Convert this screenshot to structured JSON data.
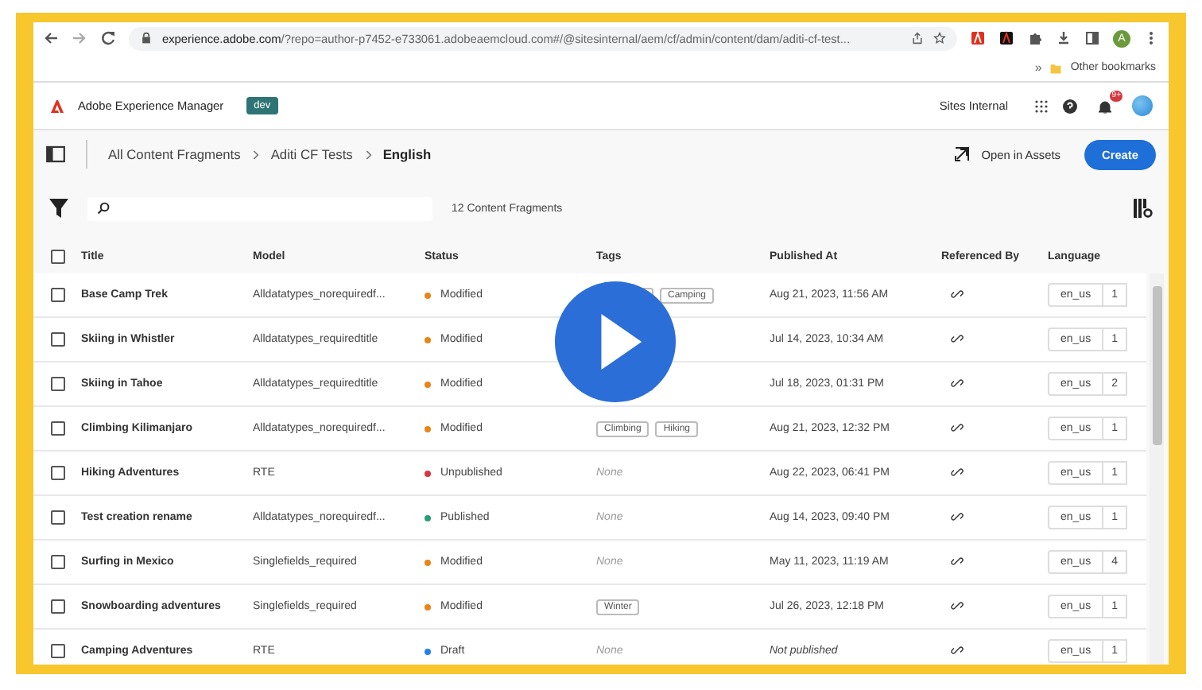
{
  "browser": {
    "url_host": "experience.adobe.com",
    "url_rest": "/?repo=author-p7452-e733061.adobeaemcloud.com#/@sitesinternal/aem/cf/admin/content/dam/aditi-cf-test...",
    "bookmarks_more": "»",
    "bookmark": "Other bookmarks",
    "profile": "A"
  },
  "app": {
    "product": "Adobe Experience Manager",
    "env": "dev",
    "org": "Sites Internal",
    "notification_badge": "9+"
  },
  "breadcrumb": [
    {
      "label": "All Content Fragments",
      "current": false
    },
    {
      "label": "Aditi CF Tests",
      "current": false
    },
    {
      "label": "English",
      "current": true
    }
  ],
  "actions": {
    "open_assets": "Open in Assets",
    "create": "Create"
  },
  "toolbar": {
    "count": "12 Content Fragments"
  },
  "table": {
    "columns": [
      "Title",
      "Model",
      "Status",
      "Tags",
      "Published At",
      "Referenced By",
      "Language"
    ],
    "select_all_checked": false,
    "rows": [
      {
        "checked": false,
        "hidden_tag": true,
        "title": "Base Camp Trek",
        "model": "Alldatatypes_norequiredf...",
        "status": "Modified",
        "color": "#e68619",
        "tags": [
          "Camping"
        ],
        "published": "Aug 21, 2023, 11:56 AM",
        "published_missing": false,
        "language": "en_us",
        "versions": "1"
      },
      {
        "checked": false,
        "title": "Skiing in Whistler",
        "model": "Alldatatypes_requiredtitle",
        "status": "Modified",
        "color": "#e68619",
        "published": "Jul 14, 2023, 10:34 AM",
        "published_missing": false,
        "language": "en_us",
        "versions": "1"
      },
      {
        "checked": false,
        "hidden_tag": true,
        "title": "Skiing in Tahoe",
        "model": "Alldatatypes_requiredtitle",
        "status": "Modified",
        "color": "#e68619",
        "published": "Jul 18, 2023, 01:31 PM",
        "published_missing": false,
        "language": "en_us",
        "versions": "2"
      },
      {
        "checked": false,
        "title": "Climbing Kilimanjaro",
        "model": "Alldatatypes_norequiredf...",
        "status": "Modified",
        "color": "#e68619",
        "tags": [
          "Climbing",
          "Hiking"
        ],
        "published": "Aug 21, 2023, 12:32 PM",
        "published_missing": false,
        "language": "en_us",
        "versions": "1"
      },
      {
        "checked": false,
        "title": "Hiking Adventures",
        "model": "RTE",
        "status": "Unpublished",
        "color": "#d7373f",
        "tags_text": "None",
        "published": "Aug 22, 2023, 06:41 PM",
        "published_missing": false,
        "language": "en_us",
        "versions": "1"
      },
      {
        "checked": false,
        "title": "Test creation rename",
        "model": "Alldatatypes_norequiredf...",
        "status": "Published",
        "color": "#2d9d78",
        "tags_text": "None",
        "published": "Aug 14, 2023, 09:40 PM",
        "published_missing": false,
        "language": "en_us",
        "versions": "1"
      },
      {
        "checked": false,
        "title": "Surfing in Mexico",
        "model": "Singlefields_required",
        "status": "Modified",
        "color": "#e68619",
        "tags_text": "None",
        "published": "May 11, 2023, 11:19 AM",
        "published_missing": false,
        "language": "en_us",
        "versions": "4"
      },
      {
        "checked": false,
        "title": "Snowboarding adventures",
        "model": "Singlefields_required",
        "status": "Modified",
        "color": "#e68619",
        "tags": [
          "Winter"
        ],
        "published": "Jul 26, 2023, 12:18 PM",
        "published_missing": false,
        "language": "en_us",
        "versions": "1"
      },
      {
        "checked": false,
        "title": "Camping Adventures",
        "model": "RTE",
        "status": "Draft",
        "color": "#2680eb",
        "tags_text": "None",
        "published": "Not published",
        "published_missing": true,
        "language": "en_us",
        "versions": "1"
      }
    ]
  }
}
